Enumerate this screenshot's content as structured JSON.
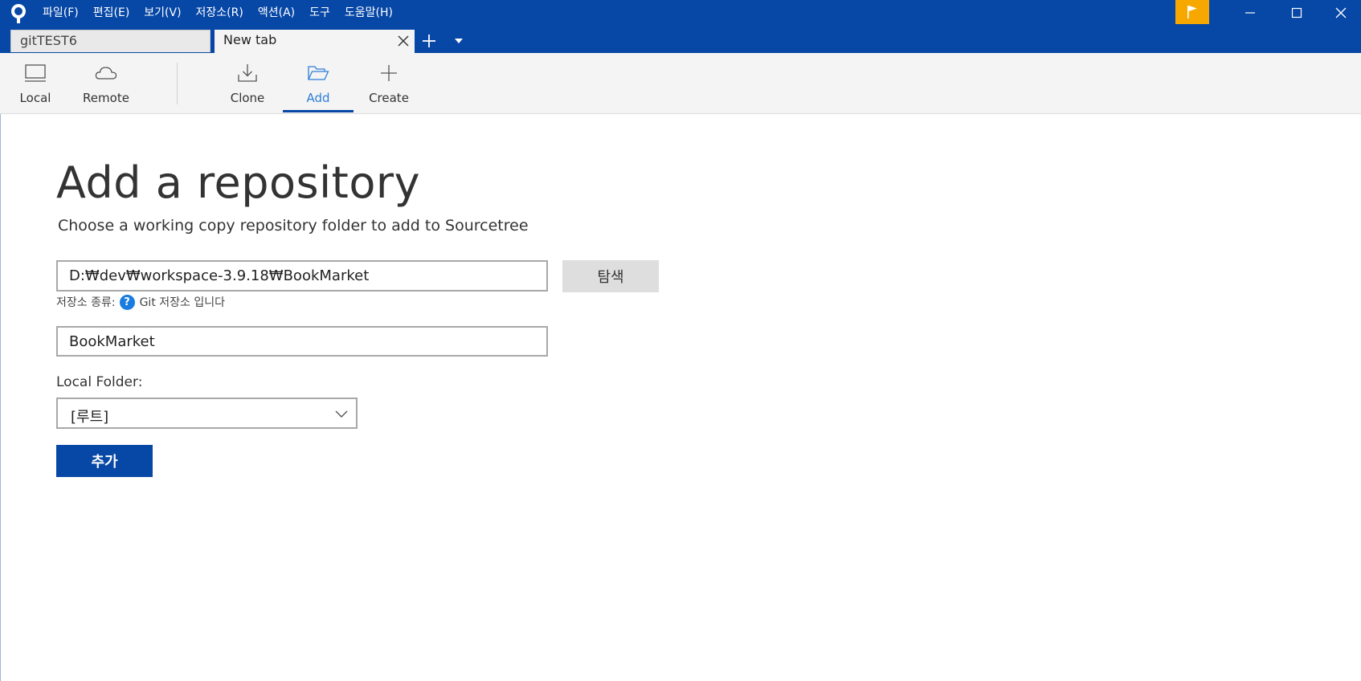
{
  "menu": [
    "파일(F)",
    "편집(E)",
    "보기(V)",
    "저장소(R)",
    "액션(A)",
    "도구",
    "도움말(H)"
  ],
  "tabs": [
    {
      "label": "gitTEST6",
      "active": false
    },
    {
      "label": "New tab",
      "active": true
    }
  ],
  "toolbar": {
    "local": "Local",
    "remote": "Remote",
    "clone": "Clone",
    "add": "Add",
    "create": "Create",
    "selected": "Add"
  },
  "main": {
    "title": "Add a repository",
    "subtitle": "Choose a working copy repository folder to add to Sourcetree",
    "path_value": "D:₩dev₩workspace-3.9.18₩BookMarket",
    "browse_label": "탐색",
    "repo_type_label": "저장소 종류:",
    "repo_type_help": "?",
    "repo_type_value": "Git 저장소 입니다",
    "name_value": "BookMarket",
    "local_folder_label": "Local Folder:",
    "local_folder_value": "[루트]",
    "add_button": "추가"
  },
  "colors": {
    "titlebar": "#0747a6",
    "flag": "#f6a800",
    "accent": "#0747a6",
    "link": "#2f7ed8"
  },
  "icons": {
    "app": "sourcetree-logo-icon",
    "flag": "flag-icon",
    "local": "monitor-icon",
    "remote": "cloud-icon",
    "clone": "download-icon",
    "add": "folder-open-icon",
    "create": "plus-icon"
  }
}
